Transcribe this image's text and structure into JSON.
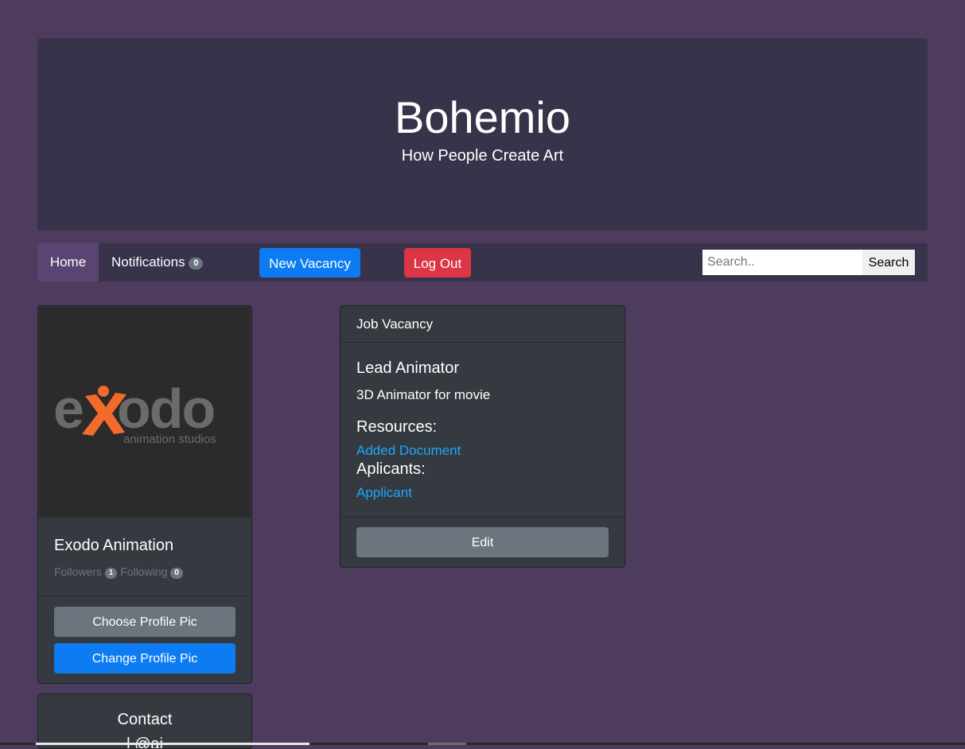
{
  "header": {
    "title": "Bohemio",
    "subtitle": "How People Create Art"
  },
  "navbar": {
    "home_label": "Home",
    "notifications_label": "Notifications",
    "notifications_count": "0",
    "new_vacancy_label": "New Vacancy",
    "logout_label": "Log Out",
    "search_placeholder": "Search..",
    "search_button_label": "Search"
  },
  "profile": {
    "logo_main": "exodo",
    "logo_sub": "animation studios",
    "name": "Exodo Animation",
    "followers_label": "Followers",
    "followers_count": "1",
    "following_label": "Following",
    "following_count": "0",
    "choose_pic_label": "Choose Profile Pic",
    "change_pic_label": "Change Profile Pic"
  },
  "contact": {
    "title": "Contact",
    "partial": "l @ai"
  },
  "job": {
    "header": "Job Vacancy",
    "title": "Lead Animator",
    "description": "3D Animator for movie",
    "resources_heading": "Resources:",
    "document_link": "Added Document",
    "applicants_heading": "Aplicants:",
    "applicant_link": "Applicant",
    "edit_label": "Edit"
  },
  "colors": {
    "page_bg": "#4e3c5e",
    "panel_bg": "#38334a",
    "card_bg": "#343a40",
    "primary": "#0d7cf2",
    "danger": "#dc3545",
    "secondary": "#6c757d",
    "link": "#1ea7fd",
    "logo_orange": "#f26b2b"
  }
}
